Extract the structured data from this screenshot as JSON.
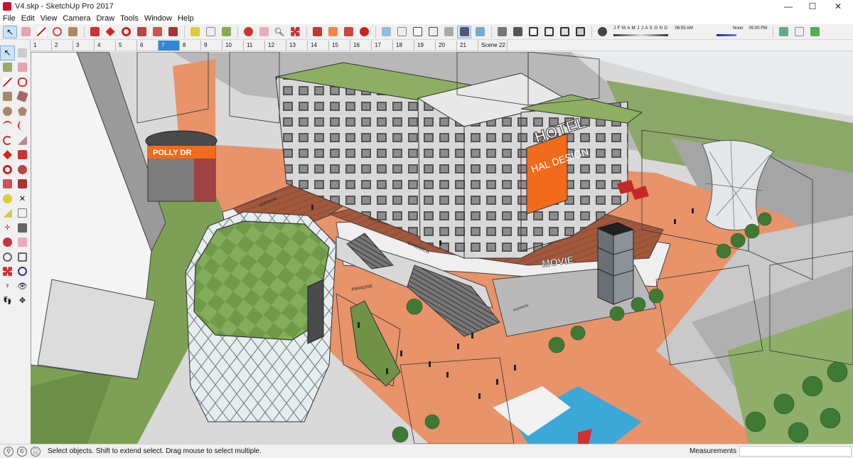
{
  "window": {
    "title": "V4.skp - SketchUp Pro 2017",
    "minimize_glyph": "—",
    "maximize_glyph": "☐",
    "close_glyph": "✕"
  },
  "menu": [
    "File",
    "Edit",
    "View",
    "Camera",
    "Draw",
    "Tools",
    "Window",
    "Help"
  ],
  "shadow_panel": {
    "months": "J F M A M J J A S O N D",
    "time_start": "06:55 AM",
    "time_mid": "Noon",
    "time_end": "05:00 PM"
  },
  "scenes": {
    "tabs": [
      "1",
      "2",
      "3",
      "4",
      "5",
      "6",
      "7",
      "8",
      "9",
      "10",
      "11",
      "12",
      "13",
      "14",
      "15",
      "16",
      "17",
      "18",
      "19",
      "20",
      "21",
      "Scene 22"
    ],
    "active": "7"
  },
  "model_labels": {
    "hotel_sign": "HOTEL",
    "hal_design": "HAL DESIGN",
    "polly_drum": "POLLY DR",
    "movie": "MOVIE",
    "versio_1": "VERSION",
    "versio_2": "VERSION",
    "mall_lower": "SANDWICH",
    "paradise": "PARADISE",
    "shop_right": "FASHION"
  },
  "status": {
    "text": "Select objects. Shift to extend select. Drag mouse to select multiple.",
    "measurements_label": "Measurements",
    "measurements_value": ""
  },
  "colors": {
    "terracotta": "#e8936a",
    "lawn": "#7da055",
    "facade": "#dcdcdc",
    "hal_orange": "#f26b1d",
    "scene_active": "#3385d6"
  }
}
